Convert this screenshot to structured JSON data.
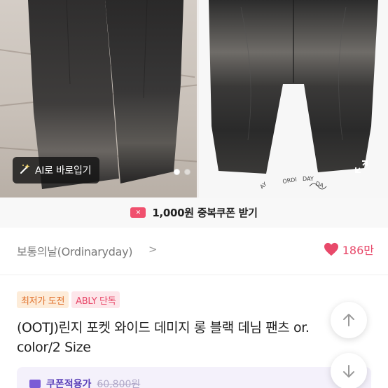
{
  "gallery": {
    "ai_button_label": "AI로 바로입기",
    "ai_icon": "magic-wand-icon",
    "expand_icon": "expand-icon",
    "slide_count": 2,
    "active_slide": 1
  },
  "coupon_banner": {
    "icon": "coupon-icon",
    "text": "1,000원 중복쿠폰 받기"
  },
  "store": {
    "name": "보통의날(Ordinaryday)",
    "chevron": ">",
    "like_icon": "heart-icon",
    "like_count": "186만"
  },
  "badges": {
    "lowest": "최저가 도전",
    "ably": "ABLY 단독"
  },
  "product": {
    "title_line1": "(OOTJ)린지 포켓 와이드 데미지 롱 블랙 데님 팬츠 or.",
    "title_line2": "color/2 Size"
  },
  "coupon_price": {
    "label": "쿠폰적용가",
    "value": "60,800원"
  },
  "scroll": {
    "up_icon": "arrow-up-icon",
    "down_icon": "arrow-down-icon"
  },
  "colors": {
    "brand_pink": "#e8496a",
    "coupon_red": "#f0506e",
    "lowest_orange": "#e0702a",
    "coupon_purple": "#7b5bd6"
  }
}
